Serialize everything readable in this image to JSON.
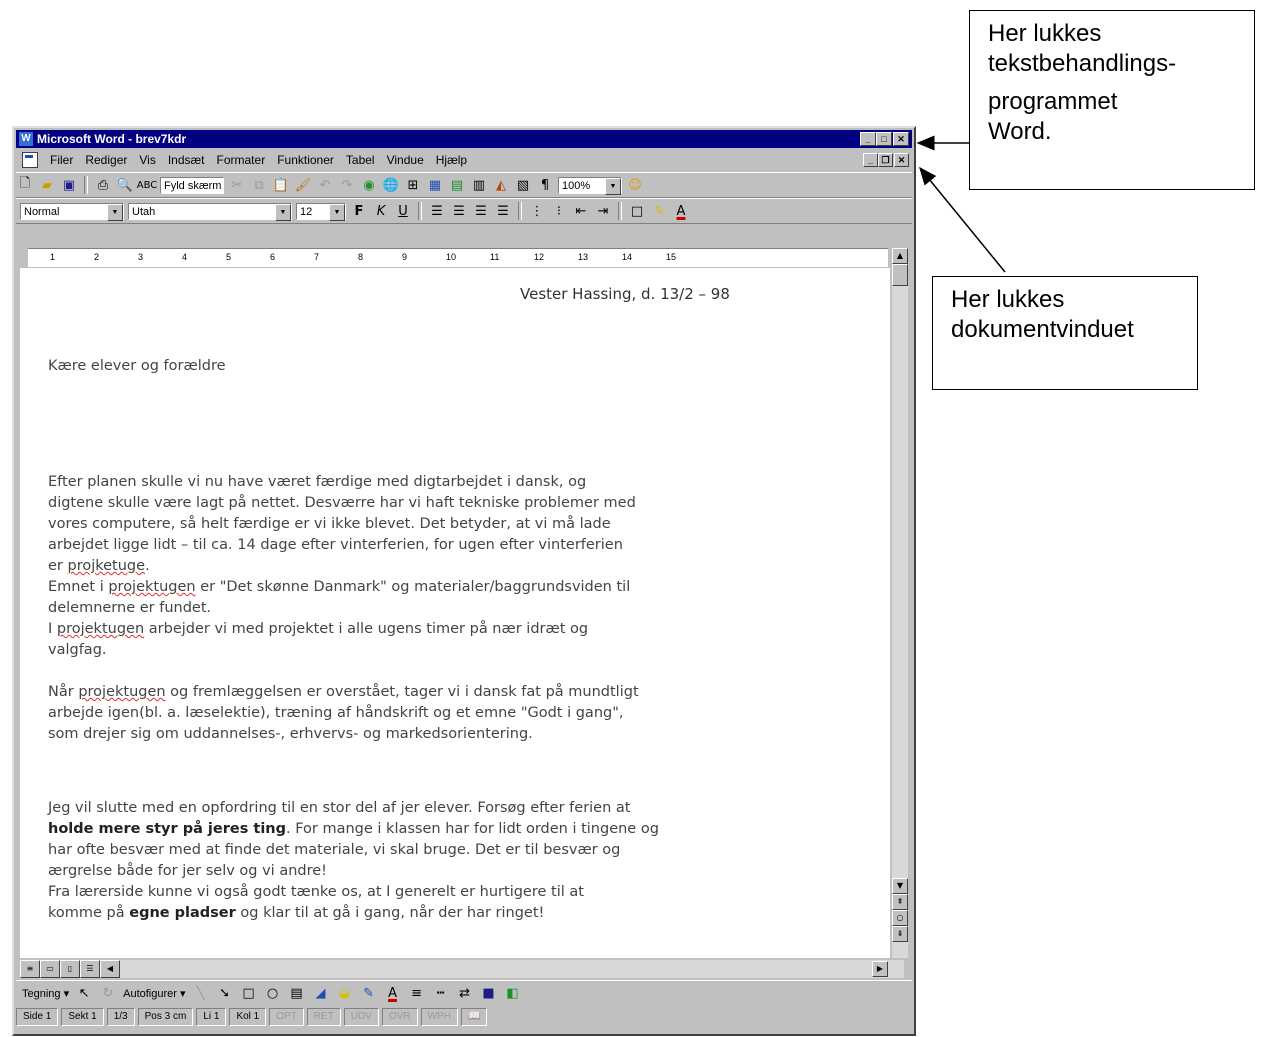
{
  "annotations": {
    "close_app": [
      "Her lukkes",
      "tekstbehandlings-",
      "programmet",
      "Word."
    ],
    "close_doc": [
      "Her lukkes",
      "dokumentvinduet"
    ]
  },
  "window": {
    "title": "Microsoft Word - brev7kdr",
    "menu": [
      "Filer",
      "Rediger",
      "Vis",
      "Indsæt",
      "Formater",
      "Funktioner",
      "Tabel",
      "Vindue",
      "Hjælp"
    ],
    "style_box": "Normal",
    "font_box": "Utah",
    "size_box": "12",
    "zoom_box": "100%",
    "send_label": "Fyld skærm",
    "ruler_labels": [
      "1",
      "2",
      "3",
      "4",
      "5",
      "6",
      "7",
      "8",
      "9",
      "10",
      "11",
      "12",
      "13",
      "14",
      "15"
    ]
  },
  "document": {
    "date_line": "Vester Hassing, d. 13/2 – 98",
    "greeting": "Kære elever og forældre",
    "p1": [
      "Efter planen skulle vi nu have været færdige med digtarbejdet i dansk, og",
      "digtene skulle være lagt på nettet. Desværre har vi haft tekniske problemer med",
      "vores computere, så helt færdige er vi ikke blevet. Det betyder, at vi må lade",
      "arbejdet ligge lidt – til ca. 14 dage efter vinterferien, for ugen efter vinterferien"
    ],
    "p1_end_pre": "er ",
    "p1_end_err": "projketuge",
    "p1_end_post": ".",
    "p2_pre": "Emnet i ",
    "p2_err": "projektugen",
    "p2_post": " er \"Det skønne Danmark\" og materialer/baggrundsviden til",
    "p2_l2": "delemnerne er fundet.",
    "p3_pre": "I ",
    "p3_err": "projektugen",
    "p3_post": " arbejder vi med projektet i alle ugens timer på nær idræt og",
    "p3_l2": "valgfag.",
    "p4_pre": "Når ",
    "p4_err": "projektugen",
    "p4_post": " og fremlæggelsen er overstået, tager vi i dansk fat på mundtligt",
    "p4_l2": "arbejde igen(bl. a. læselektie), træning af håndskrift og et emne \"Godt i gang\",",
    "p4_l3": "som drejer sig om uddannelses-, erhvervs- og markedsorientering.",
    "p5_l1": "Jeg vil slutte med en opfordring til en stor del af jer elever. Forsøg efter ferien at",
    "p5_bold": "holde mere styr på jeres ting",
    "p5_l2_post": ". For mange i klassen har for lidt orden i tingene og",
    "p5_l3": "har ofte besvær med at finde det materiale, vi skal bruge. Det er til besvær og",
    "p5_l4": "ærgrelse både for jer selv og vi andre!",
    "p5_l5": "Fra lærerside kunne vi også godt tænke os, at I generelt er hurtigere til at",
    "p5_l6_pre": "komme på ",
    "p5_l6_bold": "egne pladser",
    "p5_l6_post": " og klar til at gå i gang, når der har ringet!"
  },
  "drawing": {
    "draw_label": "Tegning ▾",
    "autoshapes_label": "Autofigurer ▾"
  },
  "status": [
    "Side 1",
    "Sekt 1",
    "1/3",
    "Pos 3 cm",
    "Li 1",
    "Kol 1"
  ],
  "status_dim": [
    "OPT",
    "RET",
    "UDV",
    "OVR",
    "WPH"
  ]
}
